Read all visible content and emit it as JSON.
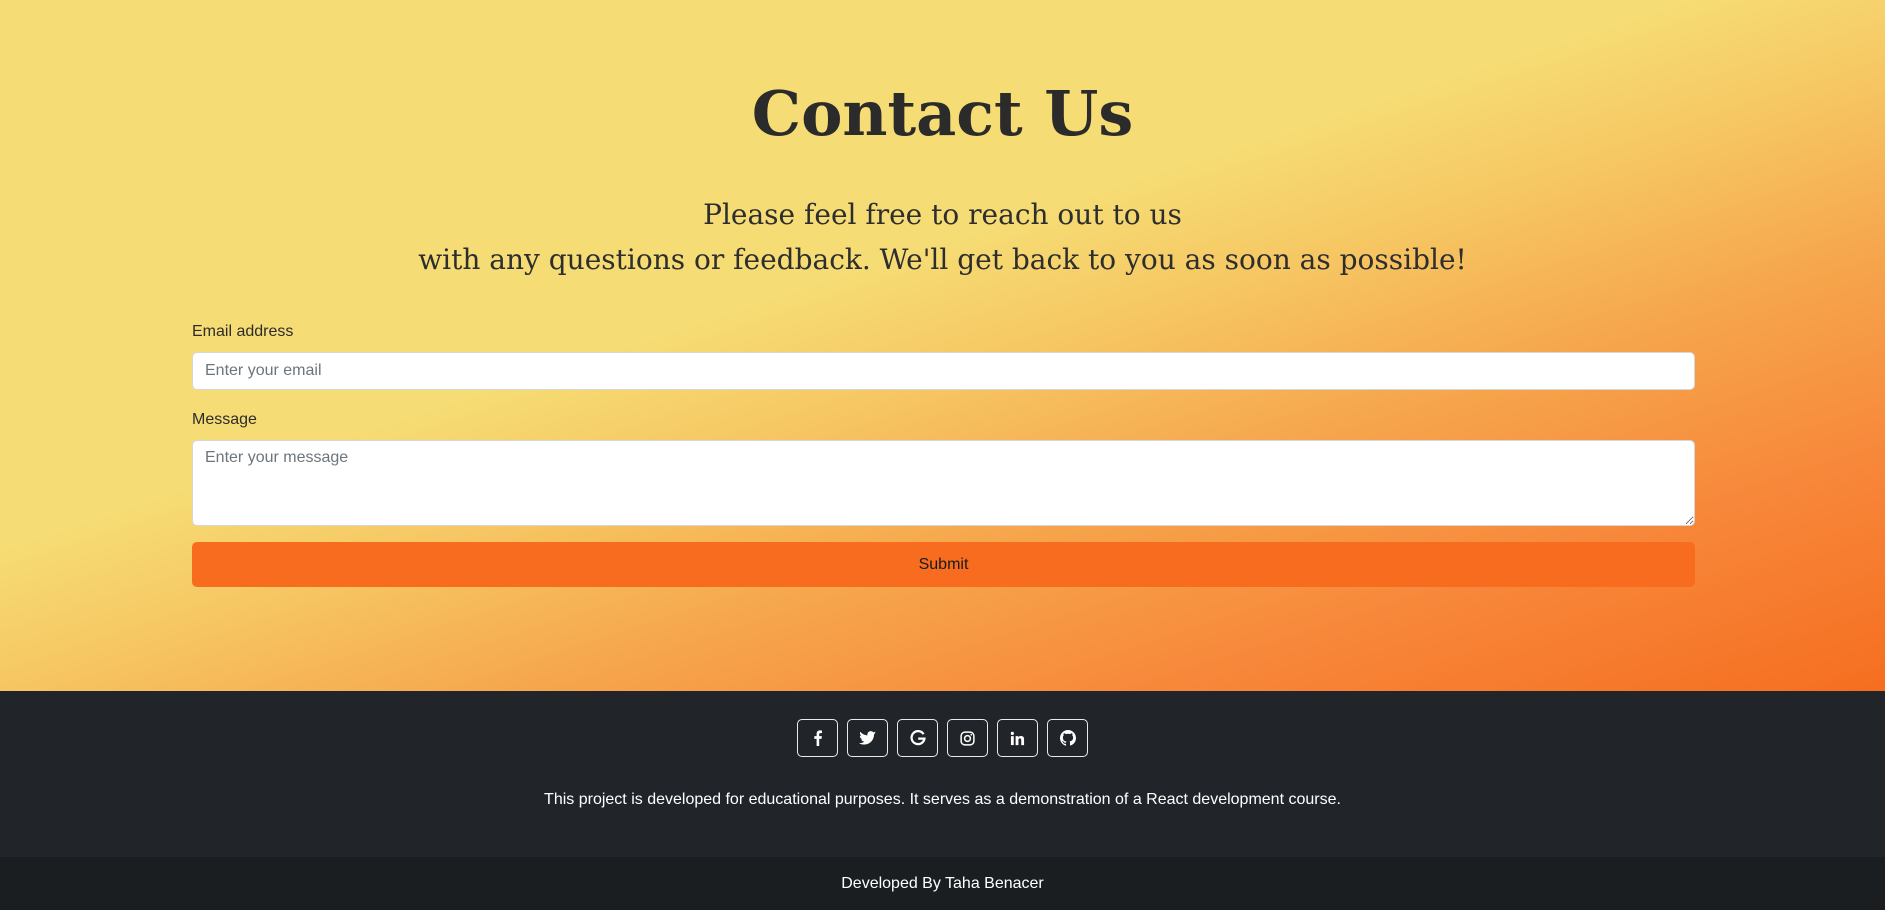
{
  "hero": {
    "title": "Contact Us",
    "lead_line1": "Please feel free to reach out to us",
    "lead_line2": "with any questions or feedback. We'll get back to you as soon as possible!"
  },
  "form": {
    "email_label": "Email address",
    "email_placeholder": "Enter your email",
    "email_value": "",
    "message_label": "Message",
    "message_placeholder": "Enter your message",
    "message_value": "",
    "submit_label": "Submit"
  },
  "footer": {
    "socials": [
      {
        "icon": "facebook-icon"
      },
      {
        "icon": "twitter-icon"
      },
      {
        "icon": "google-icon"
      },
      {
        "icon": "instagram-icon"
      },
      {
        "icon": "linkedin-icon"
      },
      {
        "icon": "github-icon"
      }
    ],
    "text": "This project is developed for educational purposes. It serves as a demonstration of a React development course."
  },
  "copyright": {
    "prefix": "Developed By ",
    "author": "Taha Benacer"
  },
  "colors": {
    "gradient_start": "#f6dc74",
    "gradient_end": "#f66e20",
    "submit_bg": "#f76c1f",
    "footer_bg": "#212529",
    "copyright_bg": "#1b1e21"
  }
}
